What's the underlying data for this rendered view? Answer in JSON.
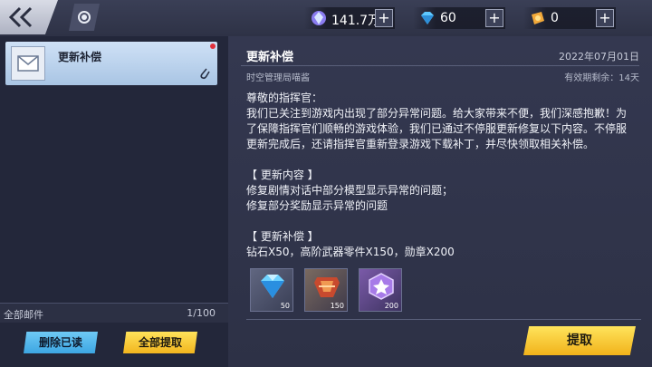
{
  "topbar": {
    "currencies": [
      {
        "icon": "crystal-icon",
        "value": "141.7万"
      },
      {
        "icon": "diamond-icon",
        "value": "60"
      },
      {
        "icon": "medal-icon",
        "value": "0"
      }
    ],
    "plus_label": "+"
  },
  "mail_list": {
    "items": [
      {
        "title": "更新补偿",
        "unread": true,
        "has_attachment": true
      }
    ],
    "count_label": "全部邮件",
    "count_value": "1/100",
    "delete_read_label": "删除已读",
    "claim_all_label": "全部提取"
  },
  "mail_detail": {
    "title": "更新补偿",
    "date": "2022年07月01日",
    "sender": "时空管理局喵酱",
    "expiry": "有效期剩余：14天",
    "body": [
      "尊敬的指挥官：",
      "我们已关注到游戏内出现了部分异常问题。给大家带来不便，我们深感抱歉！为了保障指挥官们顺畅的游戏体验，我们已通过不停服更新修复以下内容。不停服更新完成后，还请指挥官重新登录游戏下载补丁，并尽快领取相关补偿。",
      "",
      "【 更新内容 】",
      "修复剧情对话中部分模型显示异常的问题；",
      "修复部分奖励显示异常的问题",
      "",
      "【 更新补偿 】",
      "钻石X50，高阶武器零件X150，勋章X200"
    ],
    "rewards": [
      {
        "icon": "diamond-icon",
        "qty": "50"
      },
      {
        "icon": "weapon-part-icon",
        "qty": "150"
      },
      {
        "icon": "medal-icon",
        "qty": "200"
      }
    ],
    "claim_label": "提取"
  }
}
